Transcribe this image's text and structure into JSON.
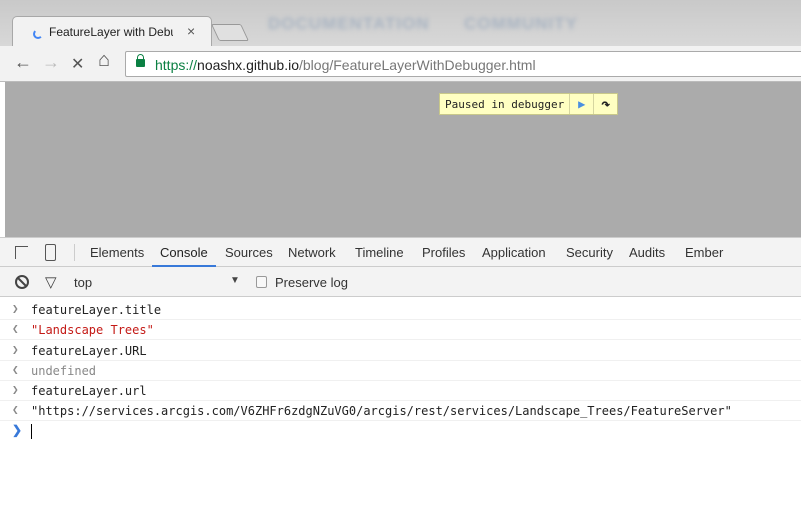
{
  "background_text": [
    "DOCUMENTATION",
    "COMMUNITY"
  ],
  "tab": {
    "title": "FeatureLayer with Debugger",
    "close": "×"
  },
  "nav": {
    "back": "←",
    "forward": "→",
    "stop": "✕",
    "home": "⌂"
  },
  "url": {
    "scheme": "https://",
    "host": "noashx.github.io",
    "path": "/blog/FeatureLayerWithDebugger.html"
  },
  "overlay": {
    "text": "Paused in debugger",
    "resume": "▶",
    "step_over": "↷"
  },
  "devtools": {
    "tabs": [
      "Elements",
      "Console",
      "Sources",
      "Network",
      "Timeline",
      "Profiles",
      "Application",
      "Security",
      "Audits",
      "Ember"
    ],
    "active_tab": "Console"
  },
  "console_toolbar": {
    "context": "top",
    "preserve_log": "Preserve log",
    "preserve_checked": false
  },
  "messages": [
    {
      "type": "input",
      "text": "featureLayer.title"
    },
    {
      "type": "output",
      "text": "\"Landscape Trees\"",
      "style": "string"
    },
    {
      "type": "input",
      "text": "featureLayer.URL"
    },
    {
      "type": "output",
      "text": "undefined",
      "style": "undefined"
    },
    {
      "type": "input",
      "text": "featureLayer.url"
    },
    {
      "type": "output",
      "text": "\"https://services.arcgis.com/V6ZHFr6zdgNZuVG0/arcgis/rest/services/Landscape_Trees/FeatureServer\"",
      "style": "plain"
    }
  ],
  "colors": {
    "accent": "#3879d9",
    "string": "#c41a16",
    "secure": "#0b8043",
    "overlay": "#ffffc2"
  }
}
